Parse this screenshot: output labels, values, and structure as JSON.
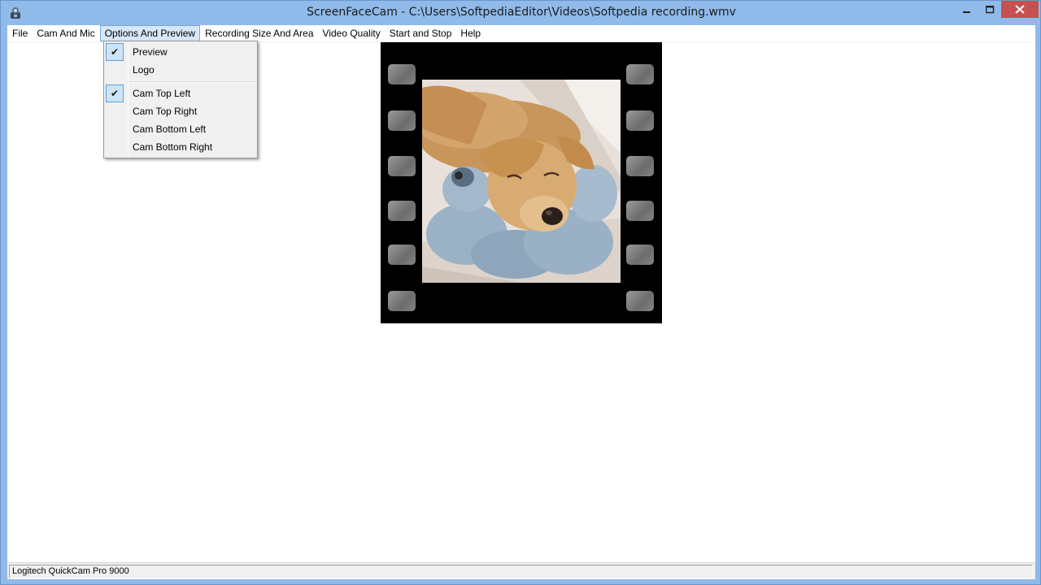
{
  "window": {
    "title": "ScreenFaceCam - C:\\Users\\SoftpediaEditor\\Videos\\Softpedia recording.wmv",
    "icon": "webcam-icon"
  },
  "menubar": {
    "items": [
      {
        "label": "File"
      },
      {
        "label": "Cam And Mic"
      },
      {
        "label": "Options And Preview"
      },
      {
        "label": "Recording Size And Area"
      },
      {
        "label": "Video Quality"
      },
      {
        "label": "Start and Stop"
      },
      {
        "label": "Help"
      }
    ],
    "active": "Options And Preview"
  },
  "options_menu": {
    "items": [
      {
        "label": "Preview",
        "checked": true
      },
      {
        "label": "Logo",
        "checked": false
      },
      {
        "label": "Cam Top Left",
        "checked": true
      },
      {
        "label": "Cam Top Right",
        "checked": false
      },
      {
        "label": "Cam Bottom Left",
        "checked": false
      },
      {
        "label": "Cam Bottom Right",
        "checked": false
      }
    ],
    "check_glyph": "✔"
  },
  "statusbar": {
    "text": "Logitech QuickCam Pro 9000"
  },
  "colors": {
    "frame": "#8fbaea",
    "close_button": "#c75050",
    "menu_highlight": "#d5e7f8",
    "check_box": "#cde4f7"
  }
}
